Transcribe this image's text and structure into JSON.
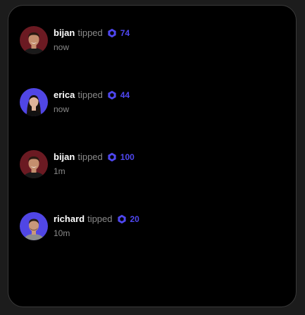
{
  "colors": {
    "background": "#000000",
    "border": "#3a3a3a",
    "username": "#ffffff",
    "secondary_text": "#8a8a8a",
    "accent": "#4f47f0",
    "avatar_bijan_bg": "#6b1a22",
    "avatar_purple_bg": "#5046e5"
  },
  "tips": [
    {
      "user": "bijan",
      "action": "tipped",
      "token_icon": "hexagon-token-icon",
      "amount": "74",
      "time": "now"
    },
    {
      "user": "erica",
      "action": "tipped",
      "token_icon": "hexagon-token-icon",
      "amount": "44",
      "time": "now"
    },
    {
      "user": "bijan",
      "action": "tipped",
      "token_icon": "hexagon-token-icon",
      "amount": "100",
      "time": "1m"
    },
    {
      "user": "richard",
      "action": "tipped",
      "token_icon": "hexagon-token-icon",
      "amount": "20",
      "time": "10m"
    }
  ]
}
